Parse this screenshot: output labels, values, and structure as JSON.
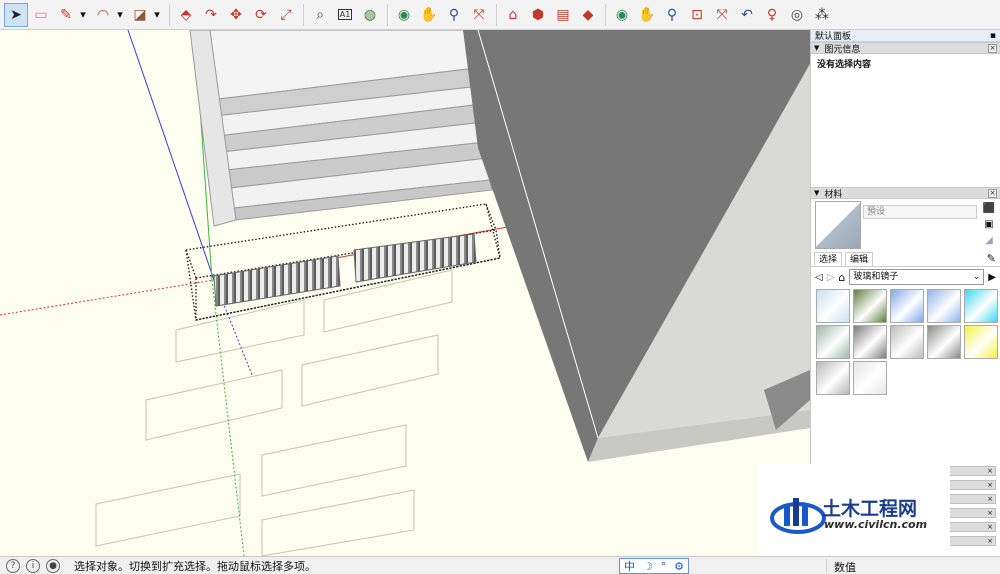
{
  "toolbar": {
    "tools": [
      {
        "name": "select-tool-button",
        "icon": "arrow-cursor-icon",
        "active": true
      },
      {
        "name": "eraser-tool-button",
        "icon": "eraser-icon"
      },
      {
        "name": "pencil-line-tool-button",
        "icon": "pencil-icon",
        "dropdown": true
      },
      {
        "name": "arc-tool-button",
        "icon": "arc-icon",
        "dropdown": true
      },
      {
        "name": "rectangle-tool-button",
        "icon": "shape-icon",
        "dropdown": true
      },
      {
        "name": "push-pull-tool-button",
        "icon": "push-pull-icon"
      },
      {
        "name": "follow-me-tool-button",
        "icon": "follow-me-icon"
      },
      {
        "name": "move-tool-button",
        "icon": "move-icon"
      },
      {
        "name": "rotate-tool-button",
        "icon": "rotate-icon"
      },
      {
        "name": "scale-tool-button",
        "icon": "scale-icon"
      },
      {
        "name": "tape-measure-tool-button",
        "icon": "tape-measure-icon"
      },
      {
        "name": "text-tool-button",
        "icon": "text-icon",
        "text": "A1"
      },
      {
        "name": "paint-bucket-tool-button",
        "icon": "paint-bucket-icon"
      },
      {
        "name": "orbit-tool-button",
        "icon": "orbit-icon"
      },
      {
        "name": "pan-tool-button",
        "icon": "pan-hand-icon"
      },
      {
        "name": "zoom-tool-button",
        "icon": "zoom-icon"
      },
      {
        "name": "zoom-extents-tool-button",
        "icon": "zoom-extents-icon"
      },
      {
        "name": "warehouse-button",
        "icon": "warehouse-icon"
      },
      {
        "name": "extension-warehouse-button",
        "icon": "extension-icon"
      },
      {
        "name": "send-to-layout-button",
        "icon": "layout-icon"
      },
      {
        "name": "extension-manager-button",
        "icon": "ruby-icon"
      },
      {
        "name": "orbit2-tool-button",
        "icon": "orbit-icon"
      },
      {
        "name": "pan2-tool-button",
        "icon": "pan-hand-icon"
      },
      {
        "name": "zoom2-tool-button",
        "icon": "zoom-icon"
      },
      {
        "name": "zoom-window-tool-button",
        "icon": "zoom-window-icon"
      },
      {
        "name": "zoom-extents2-tool-button",
        "icon": "zoom-extents-icon"
      },
      {
        "name": "previous-view-button",
        "icon": "previous-view-icon"
      },
      {
        "name": "position-camera-button",
        "icon": "position-camera-icon"
      },
      {
        "name": "look-around-button",
        "icon": "eye-icon"
      },
      {
        "name": "walk-tool-button",
        "icon": "footprints-icon"
      }
    ]
  },
  "panel": {
    "title": "默认面板",
    "entity_info": {
      "header": "图元信息",
      "content": "没有选择内容"
    },
    "materials": {
      "header": "材料",
      "name_placeholder": "預设",
      "tab_select": "选择",
      "tab_edit": "编辑",
      "library": "玻璃和镜子",
      "swatch_colors": [
        "#c8e0f0",
        "#5d7f3a",
        "#7fa8ee",
        "#8fb4e8",
        "#3fd7ef",
        "#9cb8a8",
        "#7d7d7d",
        "#bcbcbc",
        "#8a8a8a",
        "#f4f240",
        "#b8b8b8",
        "#e6e6e6"
      ]
    }
  },
  "watermark": {
    "cn": "土木工程网",
    "url": "www.civilcn.com"
  },
  "statusbar": {
    "message": "选择对象。切换到扩充选择。拖动鼠标选择多项。",
    "ime_char": "中",
    "measure_label": "数值"
  }
}
